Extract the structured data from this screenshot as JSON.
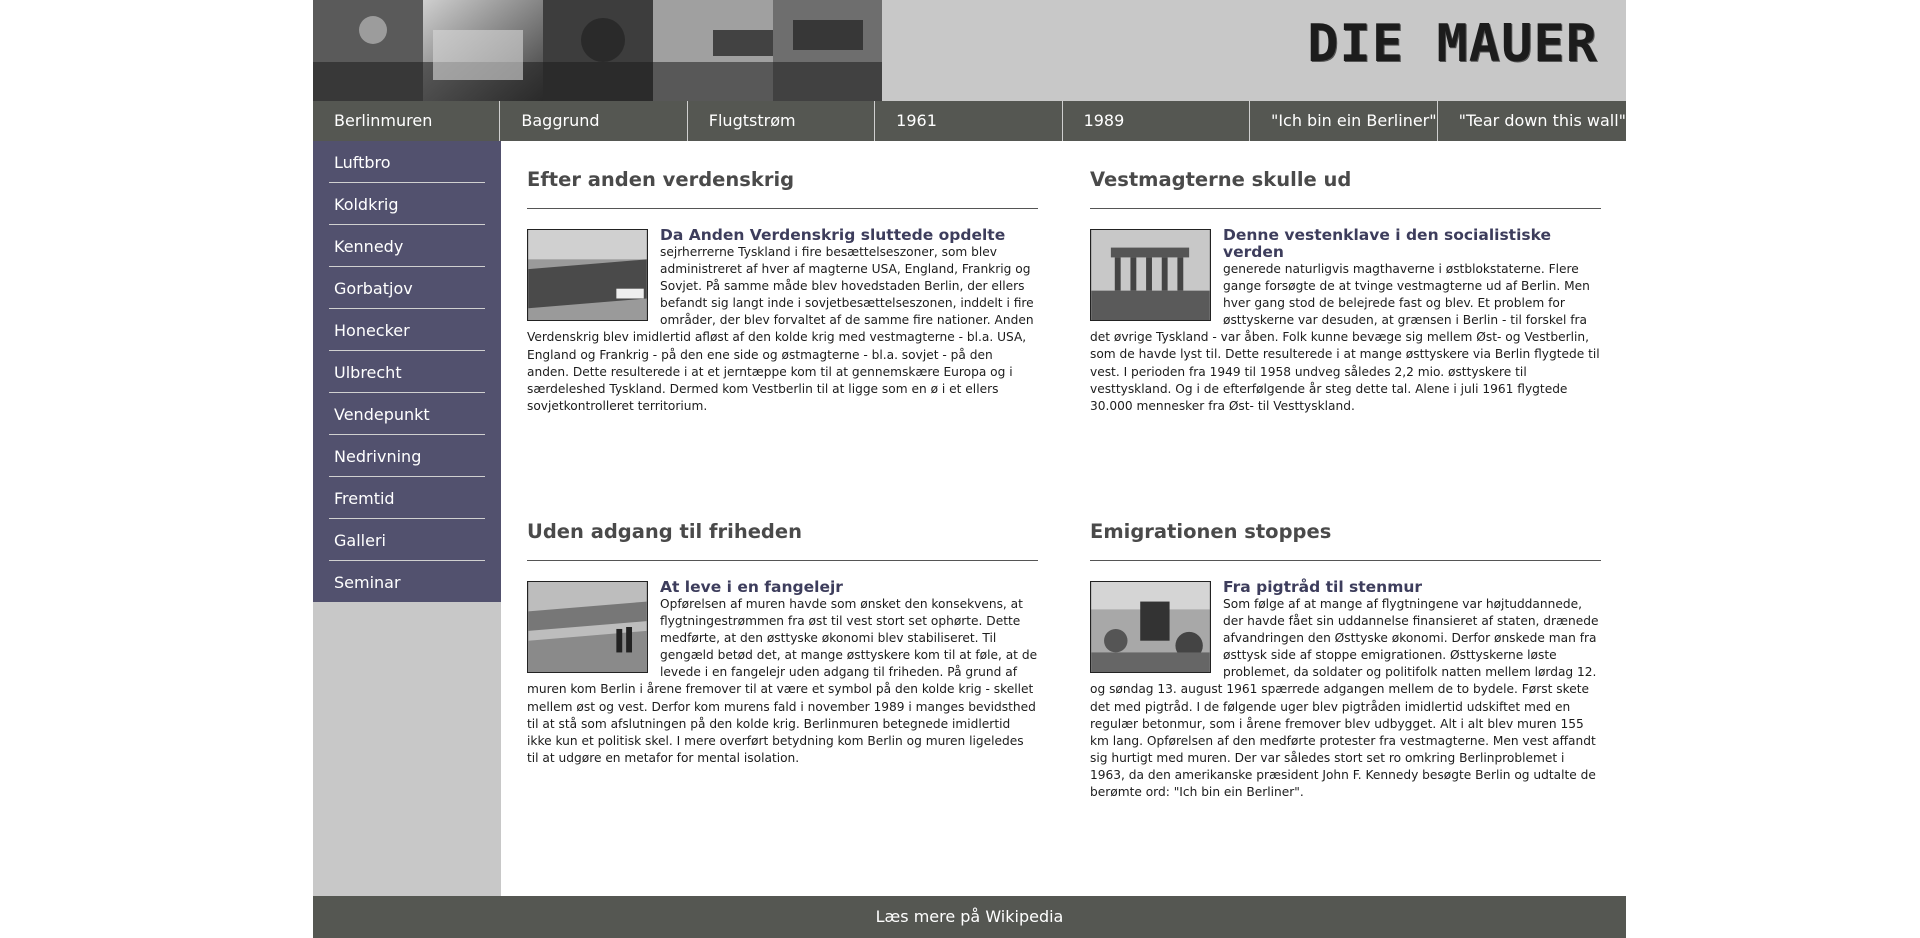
{
  "header": {
    "logo_text": "DIE MAUER"
  },
  "topnav": [
    "Berlinmuren",
    "Baggrund",
    "Flugtstrøm",
    "1961",
    "1989",
    "\"Ich bin ein Berliner\"",
    "\"Tear down this wall\""
  ],
  "sidebar": [
    "Luftbro",
    "Koldkrig",
    "Kennedy",
    "Gorbatjov",
    "Honecker",
    "Ulbrecht",
    "Vendepunkt",
    "Nedrivning",
    "Fremtid",
    "Galleri",
    "Seminar"
  ],
  "articles": [
    {
      "heading": "Efter anden verdenskrig",
      "subheading": "Da Anden Verdenskrig sluttede opdelte",
      "body": "sejrherrerne Tyskland i fire besættelseszoner, som blev administreret af hver af magterne USA, England, Frankrig og Sovjet. På samme måde blev hovedstaden Berlin, der ellers befandt sig langt inde i sovjetbesættelseszonen, inddelt i fire områder, der blev forvaltet af de samme fire nationer. Anden Verdenskrig blev imidlertid afløst af den kolde krig med vestmagterne - bl.a. USA, England og Frankrig - på den ene side og østmagterne - bl.a. sovjet - på den anden. Dette resulterede i at et jerntæppe kom til at gennemskære Europa og i særdeleshed Tyskland. Dermed kom Vestberlin til at ligge som en ø i et ellers sovjetkontrolleret territorium."
    },
    {
      "heading": "Vestmagterne skulle ud",
      "subheading": "Denne vestenklave i den socialistiske verden",
      "body": "generede naturligvis magthaverne i østblokstaterne. Flere gange forsøgte de at tvinge vestmagterne ud af Berlin. Men hver gang stod de belejrede fast og blev. Et problem for østtyskerne var desuden, at grænsen i Berlin - til forskel fra det øvrige Tyskland - var åben. Folk kunne bevæge sig mellem Øst- og Vestberlin, som de havde lyst til. Dette resulterede i at mange østtyskere via Berlin flygtede til vest. I perioden fra 1949 til 1958 undveg således 2,2 mio. østtyskere til vesttyskland. Og i de efterfølgende år steg dette tal. Alene i juli 1961 flygtede 30.000 mennesker fra Øst- til Vesttyskland."
    },
    {
      "heading": "Uden adgang til friheden",
      "subheading": "At leve i en fangelejr",
      "body": "Opførelsen af muren havde som ønsket den konsekvens, at flygtningestrømmen fra øst til vest stort set ophørte. Dette medførte, at den østtyske økonomi blev stabiliseret. Til gengæld betød det, at mange østtyskere kom til at føle, at de levede i en fangelejr uden adgang til friheden. På grund af muren kom Berlin i årene fremover til at være et symbol på den kolde krig - skellet mellem øst og vest. Derfor kom murens fald i november 1989 i manges bevidsthed til at stå som afslutningen på den kolde krig. Berlinmuren betegnede imidlertid ikke kun et politisk skel. I mere overført betydning kom Berlin og muren ligeledes til at udgøre en metafor for mental isolation."
    },
    {
      "heading": "Emigrationen stoppes",
      "subheading": "Fra pigtråd til stenmur",
      "body": "Som følge af at mange af flygtningene var højtuddannede, der havde fået sin uddannelse finansieret af staten, drænede afvandringen den Østtyske økonomi. Derfor ønskede man fra østtysk side af stoppe emigrationen. Østtyskerne løste problemet, da soldater og politifolk natten mellem lørdag 12. og søndag 13. august 1961 spærrede adgangen mellem de to bydele. Først skete det med pigtråd. I de følgende uger blev pigtråden imidlertid udskiftet med en regulær betonmur, som i årene fremover blev udbygget. Alt i alt blev muren 155 km lang. Opførelsen af den medførte protester fra vestmagterne. Men vest affandt sig hurtigt med muren. Der var således stort set ro omkring Berlinproblemet i 1963, da den amerikanske præsident John F. Kennedy besøgte Berlin og udtalte de berømte ord: \"Ich bin ein Berliner\"."
    }
  ],
  "footer": {
    "link_text": "Læs mere på Wikipedia"
  }
}
